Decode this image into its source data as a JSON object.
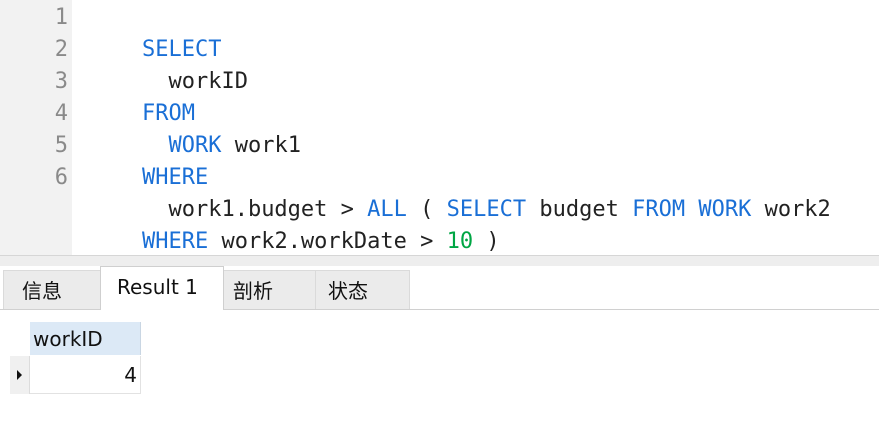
{
  "editor": {
    "line_numbers": [
      "1",
      "2",
      "3",
      "4",
      "5",
      "6"
    ],
    "lines": [
      [
        {
          "t": "SELECT",
          "k": "kw"
        }
      ],
      [
        {
          "t": "  workID",
          "k": "plain"
        }
      ],
      [
        {
          "t": "FROM",
          "k": "kw"
        }
      ],
      [
        {
          "t": "  ",
          "k": "plain"
        },
        {
          "t": "WORK",
          "k": "kw"
        },
        {
          "t": " work1",
          "k": "plain"
        }
      ],
      [
        {
          "t": "WHERE",
          "k": "kw"
        }
      ],
      [
        {
          "t": "  work1.budget > ",
          "k": "plain"
        },
        {
          "t": "ALL",
          "k": "kw"
        },
        {
          "t": " ( ",
          "k": "plain"
        },
        {
          "t": "SELECT",
          "k": "kw"
        },
        {
          "t": " budget ",
          "k": "plain"
        },
        {
          "t": "FROM",
          "k": "kw"
        },
        {
          "t": " ",
          "k": "plain"
        },
        {
          "t": "WORK",
          "k": "kw"
        },
        {
          "t": " work2",
          "k": "plain"
        }
      ],
      [
        {
          "t": "WHERE",
          "k": "kw"
        },
        {
          "t": " work2.workDate > ",
          "k": "plain"
        },
        {
          "t": "10",
          "k": "num"
        },
        {
          "t": " )",
          "k": "plain"
        }
      ]
    ],
    "colors": {
      "keyword": "#1a6fd6",
      "number": "#00a644",
      "text": "#222222",
      "line_number": "#8a8a8a"
    }
  },
  "tabs": [
    {
      "label": "信息",
      "active": false
    },
    {
      "label": "Result 1",
      "active": true
    },
    {
      "label": "剖析",
      "active": false
    },
    {
      "label": "状态",
      "active": false
    }
  ],
  "result": {
    "columns": [
      "workID"
    ],
    "rows": [
      [
        "4"
      ]
    ],
    "row_indicator_icon": "current-row-arrow-icon",
    "header_color": "#dce9f6"
  }
}
